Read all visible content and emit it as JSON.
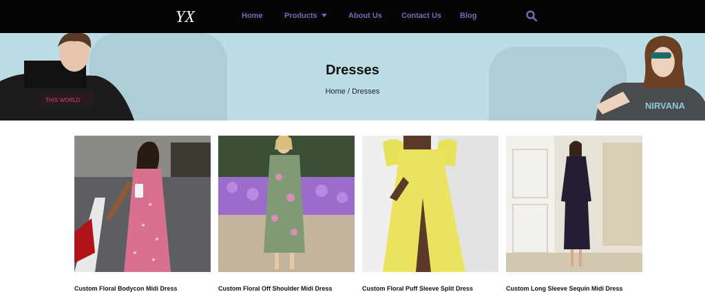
{
  "brand": {
    "logo_text": "YX"
  },
  "nav": {
    "items": [
      {
        "label": "Home"
      },
      {
        "label": "Products",
        "has_dropdown": true
      },
      {
        "label": "About Us"
      },
      {
        "label": "Contact Us"
      },
      {
        "label": "Blog"
      }
    ],
    "search_icon": "search-icon"
  },
  "banner": {
    "title": "Dresses",
    "breadcrumb": "Home / Dresses"
  },
  "products": [
    {
      "name": "Custom Floral Bodycon Midi Dress"
    },
    {
      "name": "Custom Floral Off Shoulder Midi Dress"
    },
    {
      "name": "Custom Floral Puff Sleeve Split Dress"
    },
    {
      "name": "Custom Long Sleeve Sequin Midi Dress"
    }
  ],
  "colors": {
    "header_bg": "#050505",
    "nav_text": "#6f6fb8",
    "banner_bg": "#bcdde6"
  }
}
